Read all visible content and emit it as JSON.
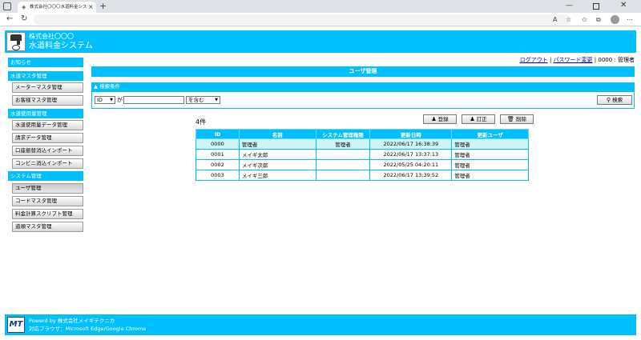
{
  "browser": {
    "tab_title": "株式会社〇〇〇水道料金システム / ユー",
    "close_glyph": "×",
    "new_tab_glyph": "+",
    "minimize_glyph": "—",
    "close_window_glyph": "✕"
  },
  "header": {
    "company": "株式会社〇〇〇",
    "system_name": "水道料金システム"
  },
  "toplinks": {
    "logout": "ログアウト",
    "sep": " | ",
    "change_password": "パスワード変更",
    "user": " | 0000 : 管理者"
  },
  "sidebar": {
    "notice": "お知らせ",
    "groups": [
      {
        "title": "水道マスタ管理",
        "items": [
          "メーターマスタ管理",
          "お客様マスタ管理"
        ]
      },
      {
        "title": "水道使用量管理",
        "items": [
          "水道使用量データ管理",
          "請求データ管理",
          "口座振替消込インポート",
          "コンビニ消込インポート"
        ]
      },
      {
        "title": "システム管理",
        "items": [
          "ユーザ管理",
          "コードマスタ管理",
          "料金計算スクリプト管理",
          "道順マスタ管理"
        ]
      }
    ]
  },
  "main": {
    "page_title": "ユーザ管理",
    "search_header": "▲ 検索条件",
    "field_select": "ID",
    "ga_label": "が",
    "search_value": "",
    "match_select": "を含む",
    "search_button": "検索",
    "register_button": "登録",
    "edit_button": "訂正",
    "delete_button": "削除",
    "count_label": "4件",
    "columns": [
      "ID",
      "名前",
      "システム管理権限",
      "更新日時",
      "更新ユーザ"
    ],
    "rows": [
      [
        "0000",
        "管理者",
        "管理者",
        "2022/06/17 16:38:39",
        "管理者"
      ],
      [
        "0001",
        "メイギ太郎",
        "",
        "2022/06/17 13:37:13",
        "管理者"
      ],
      [
        "0002",
        "メイギ次郎",
        "",
        "2022/05/25 04:20:11",
        "管理者"
      ],
      [
        "0003",
        "メイギ三郎",
        "",
        "2022/06/17 13:39:52",
        "管理者"
      ]
    ]
  },
  "footer": {
    "powered": "Powerd by 株式会社メイギテクニカ",
    "browsers": "対応ブラウザ：Microsoft Edge/Google Chrome"
  },
  "colors": {
    "accent": "#00bfff",
    "selected_row": "#cdf5f5",
    "link": "#0000cc"
  }
}
